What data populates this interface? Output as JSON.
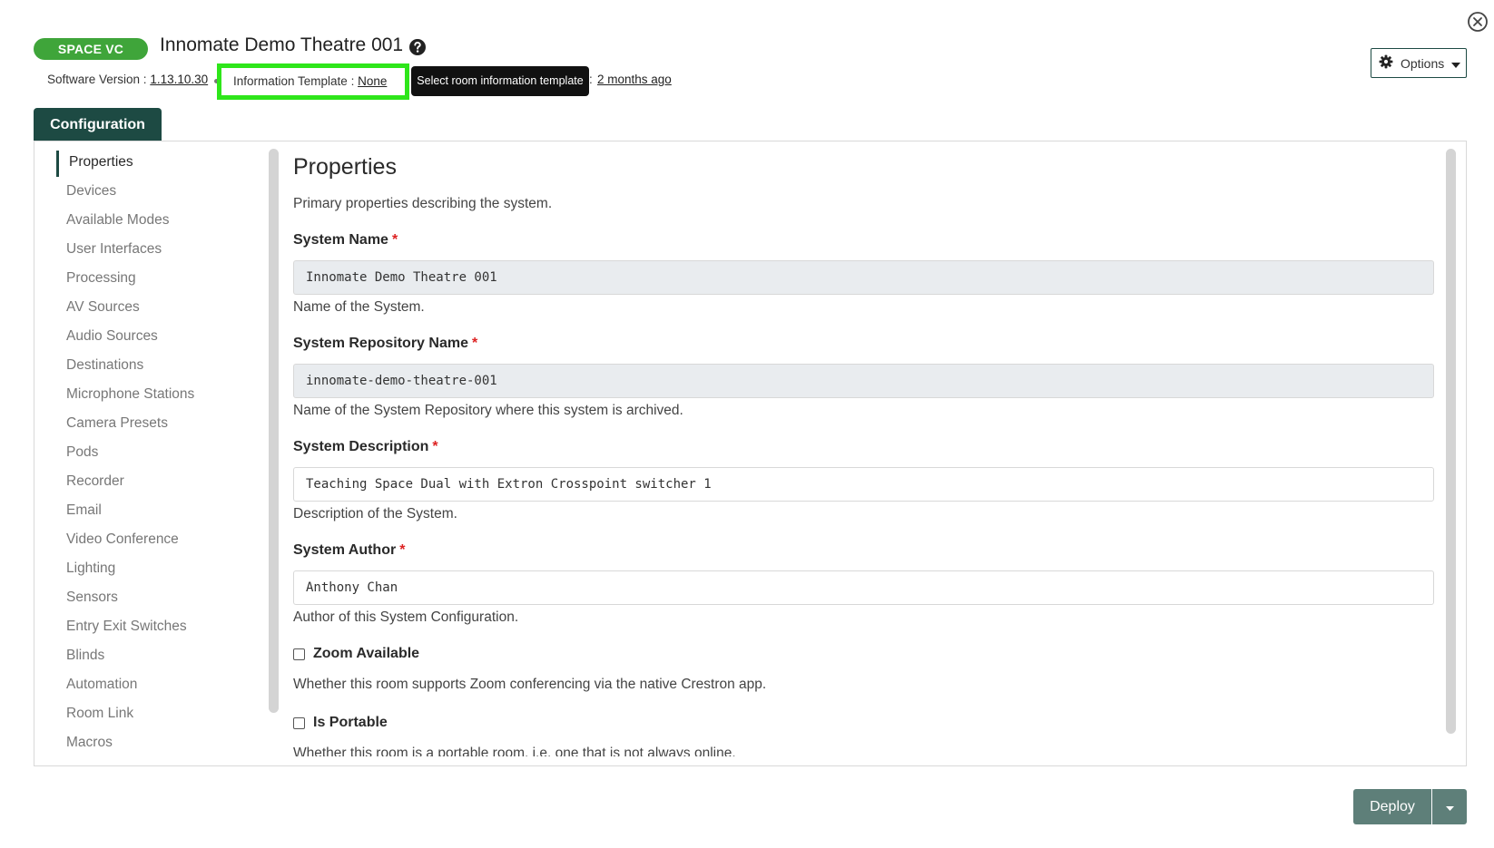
{
  "header": {
    "badge": "SPACE VC",
    "title": "Innomate Demo Theatre 001",
    "software_version_label": "Software Version :",
    "software_version": "1.13.10.30",
    "info_template_label": "Information Template :",
    "info_template_value": "None",
    "tooltip": "Select room information template",
    "separator": ":",
    "last_updated": "2 months ago",
    "options_label": "Options"
  },
  "tabs": [
    {
      "label": "Configuration",
      "active": true
    }
  ],
  "sidebar": {
    "items": [
      {
        "label": "Properties",
        "active": true
      },
      {
        "label": "Devices"
      },
      {
        "label": "Available Modes"
      },
      {
        "label": "User Interfaces"
      },
      {
        "label": "Processing"
      },
      {
        "label": "AV Sources"
      },
      {
        "label": "Audio Sources"
      },
      {
        "label": "Destinations"
      },
      {
        "label": "Microphone Stations"
      },
      {
        "label": "Camera Presets"
      },
      {
        "label": "Pods"
      },
      {
        "label": "Recorder"
      },
      {
        "label": "Email"
      },
      {
        "label": "Video Conference"
      },
      {
        "label": "Lighting"
      },
      {
        "label": "Sensors"
      },
      {
        "label": "Entry Exit Switches"
      },
      {
        "label": "Blinds"
      },
      {
        "label": "Automation"
      },
      {
        "label": "Room Link"
      },
      {
        "label": "Macros"
      }
    ]
  },
  "properties": {
    "title": "Properties",
    "subtitle": "Primary properties describing the system.",
    "fields": [
      {
        "label": "System Name",
        "required": "*",
        "value": "Innomate Demo Theatre 001",
        "help": "Name of the System.",
        "readonly": true
      },
      {
        "label": "System Repository Name",
        "required": "*",
        "value": "innomate-demo-theatre-001",
        "help": "Name of the System Repository where this system is archived.",
        "readonly": true
      },
      {
        "label": "System Description",
        "required": "*",
        "value": "Teaching Space Dual with Extron Crosspoint switcher 1",
        "help": "Description of the System.",
        "readonly": false
      },
      {
        "label": "System Author",
        "required": "*",
        "value": "Anthony Chan",
        "help": "Author of this System Configuration.",
        "readonly": false
      }
    ],
    "checkboxes": [
      {
        "label": "Zoom Available",
        "checked": false,
        "help": "Whether this room supports Zoom conferencing via the native Crestron app."
      },
      {
        "label": "Is Portable",
        "checked": false,
        "help": "Whether this room is a portable room, i.e. one that is not always online."
      }
    ]
  },
  "footer": {
    "deploy_label": "Deploy"
  },
  "colors": {
    "accent": "#1d4a43",
    "badge": "#3fa53a",
    "highlight": "#2ee61a",
    "deploy": "#5e7f79"
  }
}
